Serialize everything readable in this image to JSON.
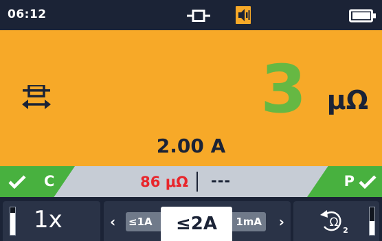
{
  "status_bar": {
    "time": "06:12",
    "connection_icon": "probe-connection-icon",
    "buzzer_icon": "buzzer-icon",
    "battery_icon": "battery-icon",
    "battery_level": 0.75
  },
  "reading": {
    "mode_icon": "continuity-mode-icon",
    "value": "3",
    "unit": "μΩ",
    "test_current": "2.00 A"
  },
  "limits": {
    "left_label": "C",
    "right_label": "P",
    "left_icon": "check-icon",
    "right_icon": "check-icon",
    "limit_value": "86 μΩ",
    "second_value": "---"
  },
  "softkeys": {
    "left": {
      "label": "1x",
      "level_icon": "level-indicator",
      "level": 0.8
    },
    "range": {
      "prev_label": "≤1A",
      "current_label": "≤2A",
      "next_label": "1mA",
      "prev_arrow": "‹",
      "next_arrow": "›"
    },
    "right": {
      "icon": "ohm-rotate-icon",
      "subscript": "2",
      "level_icon": "level-indicator",
      "level": 0.5
    }
  },
  "colors": {
    "background": "#1b2336",
    "main_panel": "#f7a928",
    "reading_value": "#66b843",
    "pass": "#48b13f",
    "limit_value": "#e8262c",
    "limit_bar": "#c6ccd5"
  }
}
